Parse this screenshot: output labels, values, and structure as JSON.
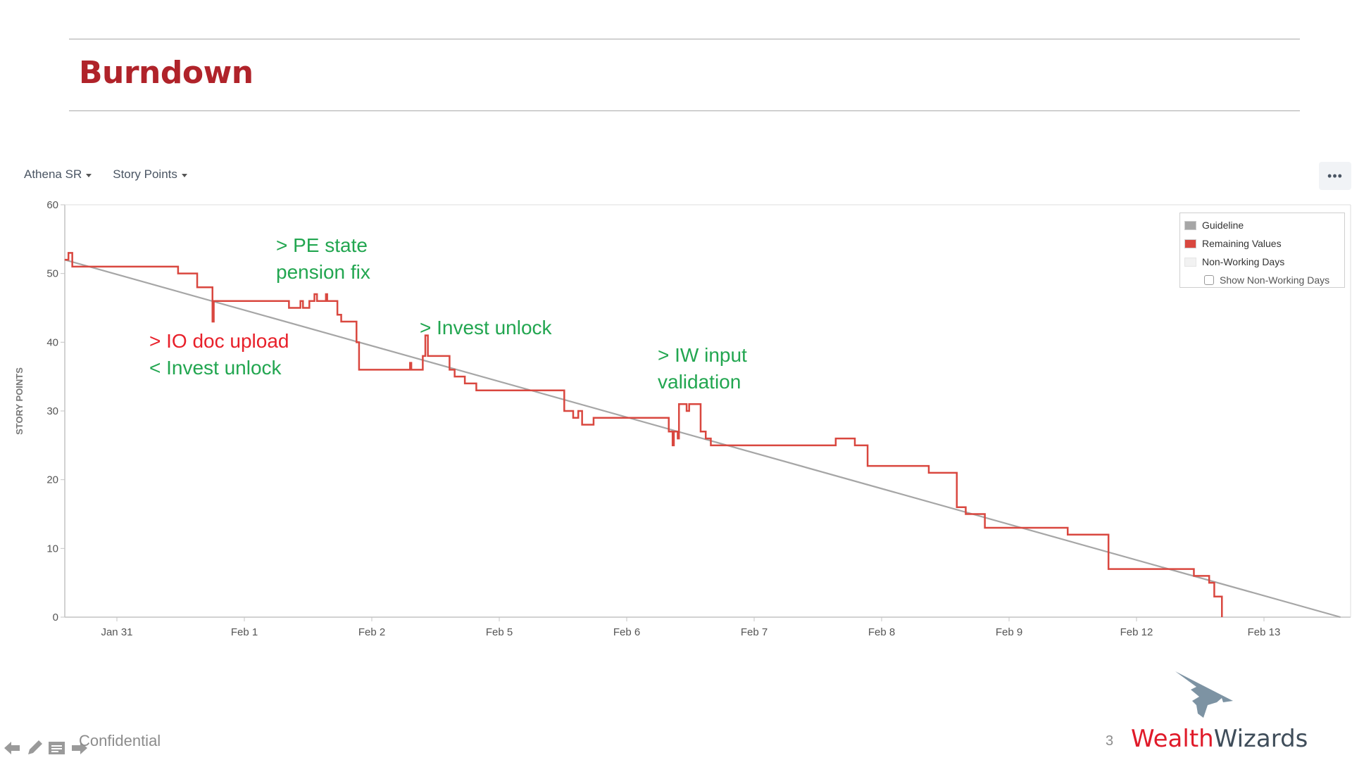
{
  "slide": {
    "title": "Burndown",
    "footer_text": "Confidential",
    "page_number": "3",
    "brand": {
      "word1": "Wealth",
      "word2": "Wizards"
    }
  },
  "toolbar": {
    "board_select": "Athena SR",
    "metric_select": "Story Points",
    "more_label": "•••"
  },
  "legend": {
    "items": [
      {
        "label": "Guideline",
        "color": "#a6a6a6"
      },
      {
        "label": "Remaining Values",
        "color": "#d9473f"
      },
      {
        "label": "Non-Working Days",
        "color": "#f2f2f2"
      }
    ],
    "checkbox_label": "Show Non-Working Days",
    "checkbox_checked": false
  },
  "annotations": [
    {
      "text1": "> PE state",
      "text2": "pension fix",
      "color": "green"
    },
    {
      "text1": "> IO doc upload",
      "color": "red",
      "text2": "< Invest unlock",
      "color2": "green"
    },
    {
      "text1": "> Invest unlock",
      "color": "green"
    },
    {
      "text1": "> IW input",
      "text2": "validation",
      "color": "green"
    }
  ],
  "chart_data": {
    "type": "line",
    "title": "Burndown",
    "xlabel": "",
    "ylabel": "STORY POINTS",
    "ylim": [
      0,
      60
    ],
    "yticks": [
      0,
      10,
      20,
      30,
      40,
      50,
      60
    ],
    "xticks": [
      "Jan 31",
      "Feb 1",
      "Feb 2",
      "Feb 5",
      "Feb 6",
      "Feb 7",
      "Feb 8",
      "Feb 9",
      "Feb 12",
      "Feb 13"
    ],
    "x_units": "working-day index (0 = Jan 31 tick)",
    "xlim": [
      -0.41,
      9.6
    ],
    "grid": false,
    "legend_position": "top-right",
    "series": [
      {
        "name": "Guideline",
        "color": "#a6a6a6",
        "points": [
          [
            -0.41,
            52
          ],
          [
            9.6,
            0
          ]
        ]
      },
      {
        "name": "Remaining Values",
        "color": "#d9473f",
        "step": true,
        "points": [
          [
            -0.41,
            52
          ],
          [
            -0.38,
            53
          ],
          [
            -0.35,
            51
          ],
          [
            0.48,
            50
          ],
          [
            0.63,
            48
          ],
          [
            0.75,
            43
          ],
          [
            0.76,
            46
          ],
          [
            1.35,
            45
          ],
          [
            1.44,
            46
          ],
          [
            1.46,
            45
          ],
          [
            1.51,
            46
          ],
          [
            1.55,
            47
          ],
          [
            1.57,
            46
          ],
          [
            1.64,
            47
          ],
          [
            1.65,
            46
          ],
          [
            1.73,
            44
          ],
          [
            1.76,
            43
          ],
          [
            1.88,
            40
          ],
          [
            1.9,
            36
          ],
          [
            2.3,
            37
          ],
          [
            2.31,
            36
          ],
          [
            2.4,
            38
          ],
          [
            2.42,
            41
          ],
          [
            2.44,
            38
          ],
          [
            2.61,
            36
          ],
          [
            2.65,
            35
          ],
          [
            2.73,
            34
          ],
          [
            2.82,
            33
          ],
          [
            3.51,
            30
          ],
          [
            3.58,
            29
          ],
          [
            3.62,
            30
          ],
          [
            3.65,
            28
          ],
          [
            3.74,
            29
          ],
          [
            4.33,
            27
          ],
          [
            4.36,
            25
          ],
          [
            4.37,
            27
          ],
          [
            4.4,
            26
          ],
          [
            4.41,
            31
          ],
          [
            4.47,
            30
          ],
          [
            4.49,
            31
          ],
          [
            4.58,
            27
          ],
          [
            4.62,
            26
          ],
          [
            4.66,
            25
          ],
          [
            5.64,
            26
          ],
          [
            5.79,
            25
          ],
          [
            5.89,
            22
          ],
          [
            6.37,
            21
          ],
          [
            6.59,
            16
          ],
          [
            6.66,
            15
          ],
          [
            6.81,
            13
          ],
          [
            7.46,
            12
          ],
          [
            7.78,
            7
          ],
          [
            8.45,
            6
          ],
          [
            8.57,
            5
          ],
          [
            8.61,
            3
          ],
          [
            8.67,
            0
          ]
        ]
      }
    ]
  }
}
